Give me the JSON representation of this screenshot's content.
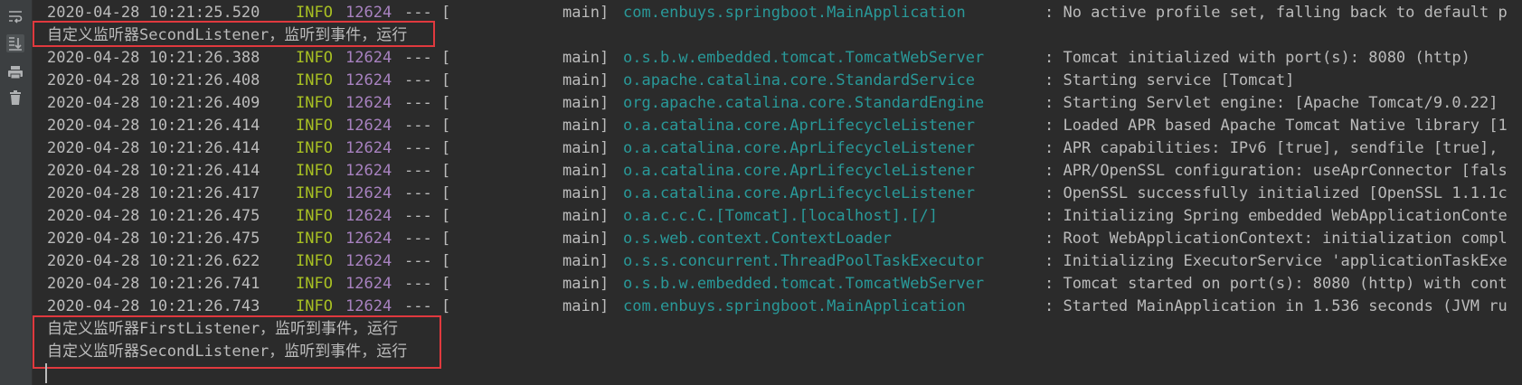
{
  "toolbar": {
    "icons": [
      "soft-wrap-icon",
      "scroll-to-end-icon",
      "print-icon",
      "clear-all-icon"
    ]
  },
  "console": {
    "lines": [
      {
        "ts": "2020-04-28 10:21:25.520",
        "level": "INFO",
        "pid": "12624",
        "sep": "--- [",
        "thread": "main]",
        "logger": "com.enbuys.springboot.MainApplication",
        "msg": ": No active profile set, falling back to default p"
      },
      {
        "plain": "自定义监听器SecondListener，监听到事件，运行"
      },
      {
        "ts": "2020-04-28 10:21:26.388",
        "level": "INFO",
        "pid": "12624",
        "sep": "--- [",
        "thread": "main]",
        "logger": "o.s.b.w.embedded.tomcat.TomcatWebServer",
        "msg": ": Tomcat initialized with port(s): 8080 (http)"
      },
      {
        "ts": "2020-04-28 10:21:26.408",
        "level": "INFO",
        "pid": "12624",
        "sep": "--- [",
        "thread": "main]",
        "logger": "o.apache.catalina.core.StandardService",
        "msg": ": Starting service [Tomcat]"
      },
      {
        "ts": "2020-04-28 10:21:26.409",
        "level": "INFO",
        "pid": "12624",
        "sep": "--- [",
        "thread": "main]",
        "logger": "org.apache.catalina.core.StandardEngine",
        "msg": ": Starting Servlet engine: [Apache Tomcat/9.0.22]"
      },
      {
        "ts": "2020-04-28 10:21:26.414",
        "level": "INFO",
        "pid": "12624",
        "sep": "--- [",
        "thread": "main]",
        "logger": "o.a.catalina.core.AprLifecycleListener",
        "msg": ": Loaded APR based Apache Tomcat Native library [1"
      },
      {
        "ts": "2020-04-28 10:21:26.414",
        "level": "INFO",
        "pid": "12624",
        "sep": "--- [",
        "thread": "main]",
        "logger": "o.a.catalina.core.AprLifecycleListener",
        "msg": ": APR capabilities: IPv6 [true], sendfile [true],"
      },
      {
        "ts": "2020-04-28 10:21:26.414",
        "level": "INFO",
        "pid": "12624",
        "sep": "--- [",
        "thread": "main]",
        "logger": "o.a.catalina.core.AprLifecycleListener",
        "msg": ": APR/OpenSSL configuration: useAprConnector [fals"
      },
      {
        "ts": "2020-04-28 10:21:26.417",
        "level": "INFO",
        "pid": "12624",
        "sep": "--- [",
        "thread": "main]",
        "logger": "o.a.catalina.core.AprLifecycleListener",
        "msg": ": OpenSSL successfully initialized [OpenSSL 1.1.1c"
      },
      {
        "ts": "2020-04-28 10:21:26.475",
        "level": "INFO",
        "pid": "12624",
        "sep": "--- [",
        "thread": "main]",
        "logger": "o.a.c.c.C.[Tomcat].[localhost].[/]",
        "msg": ": Initializing Spring embedded WebApplicationConte"
      },
      {
        "ts": "2020-04-28 10:21:26.475",
        "level": "INFO",
        "pid": "12624",
        "sep": "--- [",
        "thread": "main]",
        "logger": "o.s.web.context.ContextLoader",
        "msg": ": Root WebApplicationContext: initialization compl"
      },
      {
        "ts": "2020-04-28 10:21:26.622",
        "level": "INFO",
        "pid": "12624",
        "sep": "--- [",
        "thread": "main]",
        "logger": "o.s.s.concurrent.ThreadPoolTaskExecutor",
        "msg": ": Initializing ExecutorService 'applicationTaskExe"
      },
      {
        "ts": "2020-04-28 10:21:26.741",
        "level": "INFO",
        "pid": "12624",
        "sep": "--- [",
        "thread": "main]",
        "logger": "o.s.b.w.embedded.tomcat.TomcatWebServer",
        "msg": ": Tomcat started on port(s): 8080 (http) with cont"
      },
      {
        "ts": "2020-04-28 10:21:26.743",
        "level": "INFO",
        "pid": "12624",
        "sep": "--- [",
        "thread": "main]",
        "logger": "com.enbuys.springboot.MainApplication",
        "msg": ": Started MainApplication in 1.536 seconds (JVM ru"
      },
      {
        "plain": "自定义监听器FirstListener，监听到事件，运行"
      },
      {
        "plain": "自定义监听器SecondListener，监听到事件，运行"
      }
    ]
  },
  "colors": {
    "background": "#2b2b2b",
    "gutter": "#3c3f41",
    "level_info": "#a8c023",
    "pid": "#a882c0",
    "logger": "#299999",
    "text": "#bbbbbb",
    "highlight": "#e0393e"
  }
}
